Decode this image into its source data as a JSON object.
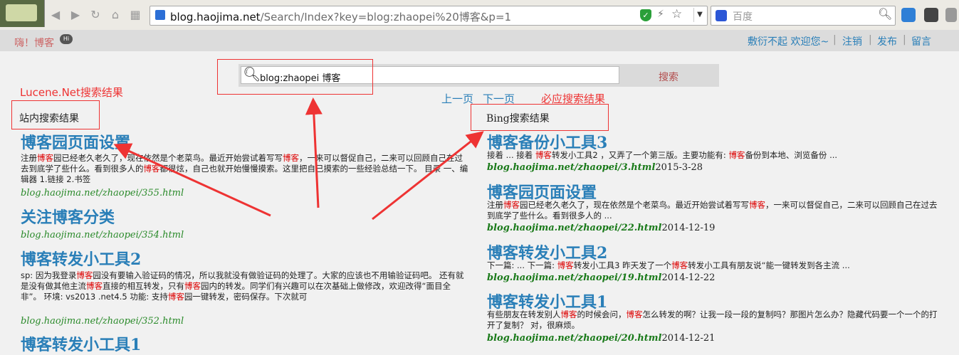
{
  "browser": {
    "url_host": "blog.haojima.net",
    "url_path": "/Search/Index?key=blog:zhaopei%20博客&p=1",
    "search_engine_placeholder": "百度",
    "url_shield_glyph": "✓",
    "nav_glyphs": {
      "back": "◀",
      "forward": "▶",
      "reload": "↻",
      "home": "⌂",
      "star": "☆",
      "apps": "▦"
    }
  },
  "site": {
    "greeting": "嗨！博客",
    "nav": {
      "sorry_welcome": "敷衍不起 欢迎您~",
      "logout": "注销",
      "publish": "发布",
      "message": "留言",
      "separator": "|"
    }
  },
  "search": {
    "value": "blog:zhaopei 博客",
    "button": "搜索"
  },
  "pager": {
    "prev": "上一页",
    "next": "下一页"
  },
  "annotations": {
    "lucene": "Lucene.Net搜索结果",
    "bing": "必应搜索结果"
  },
  "left_results": {
    "heading": "站内搜索结果",
    "items": [
      {
        "title": "博客园页面设置",
        "snippet": [
          "注册",
          "博客",
          "园已经老久老久了，现在依然是个老菜鸟。最近开始尝试着写写",
          "博客",
          "，一来可以督促自己，二来可以回顾自己在过去到底学了些什么。看到很多人的",
          "博客",
          "都很炫，自己也就开始慢慢摸索。这里把自己摸索的一些经验总结一下。 目录   一、编辑器       1.链接      2.书签"
        ],
        "url": "blog.haojima.net/zhaopei/355.html"
      },
      {
        "title": "关注博客分类",
        "snippet": [],
        "url": "blog.haojima.net/zhaopei/354.html"
      },
      {
        "title": "博客转发小工具2",
        "snippet": [
          "sp:  因为我登录",
          "博客",
          "园没有要输入验证码的情况，所以我就没有做验证码的处理了。大家的应该也不用输验证码吧。  还有就是没有做其他主流",
          "博客",
          "直接的相互转发，只有",
          "博客",
          "园内的转发。同学们有兴趣可以在次基础上做修改，欢迎改得“面目全非”。 环境:    vs2013  .net4.5 功能:   支持",
          "博客",
          "园一键转发，密码保存。下次就可"
        ],
        "url": "blog.haojima.net/zhaopei/352.html"
      },
      {
        "title": "博客转发小工具1",
        "snippet": [],
        "url": ""
      }
    ]
  },
  "right_results": {
    "heading": "Bing搜索结果",
    "items": [
      {
        "title": "博客备份小工具3",
        "snippet": [
          "接着 ...  接着 ",
          "博客",
          "转发小工具2 ，又弄了一个第三版。主要功能有: ",
          "博客",
          "备份到本地、浏览备份 ..."
        ],
        "url": "blog.haojima.net/zhaopei/3.html",
        "date": "2015-3-28"
      },
      {
        "title": "博客园页面设置",
        "snippet": [
          "注册",
          "博客",
          "园已经老久老久了，现在依然是个老菜鸟。最近开始尝试着写写",
          "博客",
          "，一来可以督促自己，二来可以回顾自己在过去到底学了些什么。看到很多人的 ..."
        ],
        "url": "blog.haojima.net/zhaopei/22.html",
        "date": "2014-12-19"
      },
      {
        "title": "博客转发小工具2",
        "snippet": [
          "下一篇: ...  下一篇: ",
          "博客",
          "转发小工具3 昨天发了一个",
          "博客",
          "转发小工具有朋友说“能一键转发到各主流 ..."
        ],
        "url": "blog.haojima.net/zhaopei/19.html",
        "date": "2014-12-22"
      },
      {
        "title": "博客转发小工具1",
        "snippet": [
          "有些朋友在转发别人",
          "博客",
          "的时候会问，",
          "博客",
          "怎么转发的啊？让我一段一段的复制吗？那图片怎么办？隐藏代码要一个一个的打开了复制？ 对，很麻烦。"
        ],
        "url": "blog.haojima.net/zhaopei/20.html",
        "date": "2014-12-21"
      }
    ]
  },
  "colors": {
    "accent": "#2a7fb8",
    "highlight": "#dd0000",
    "annotation": "#ee3333",
    "url_green": "#2a8a2a"
  }
}
